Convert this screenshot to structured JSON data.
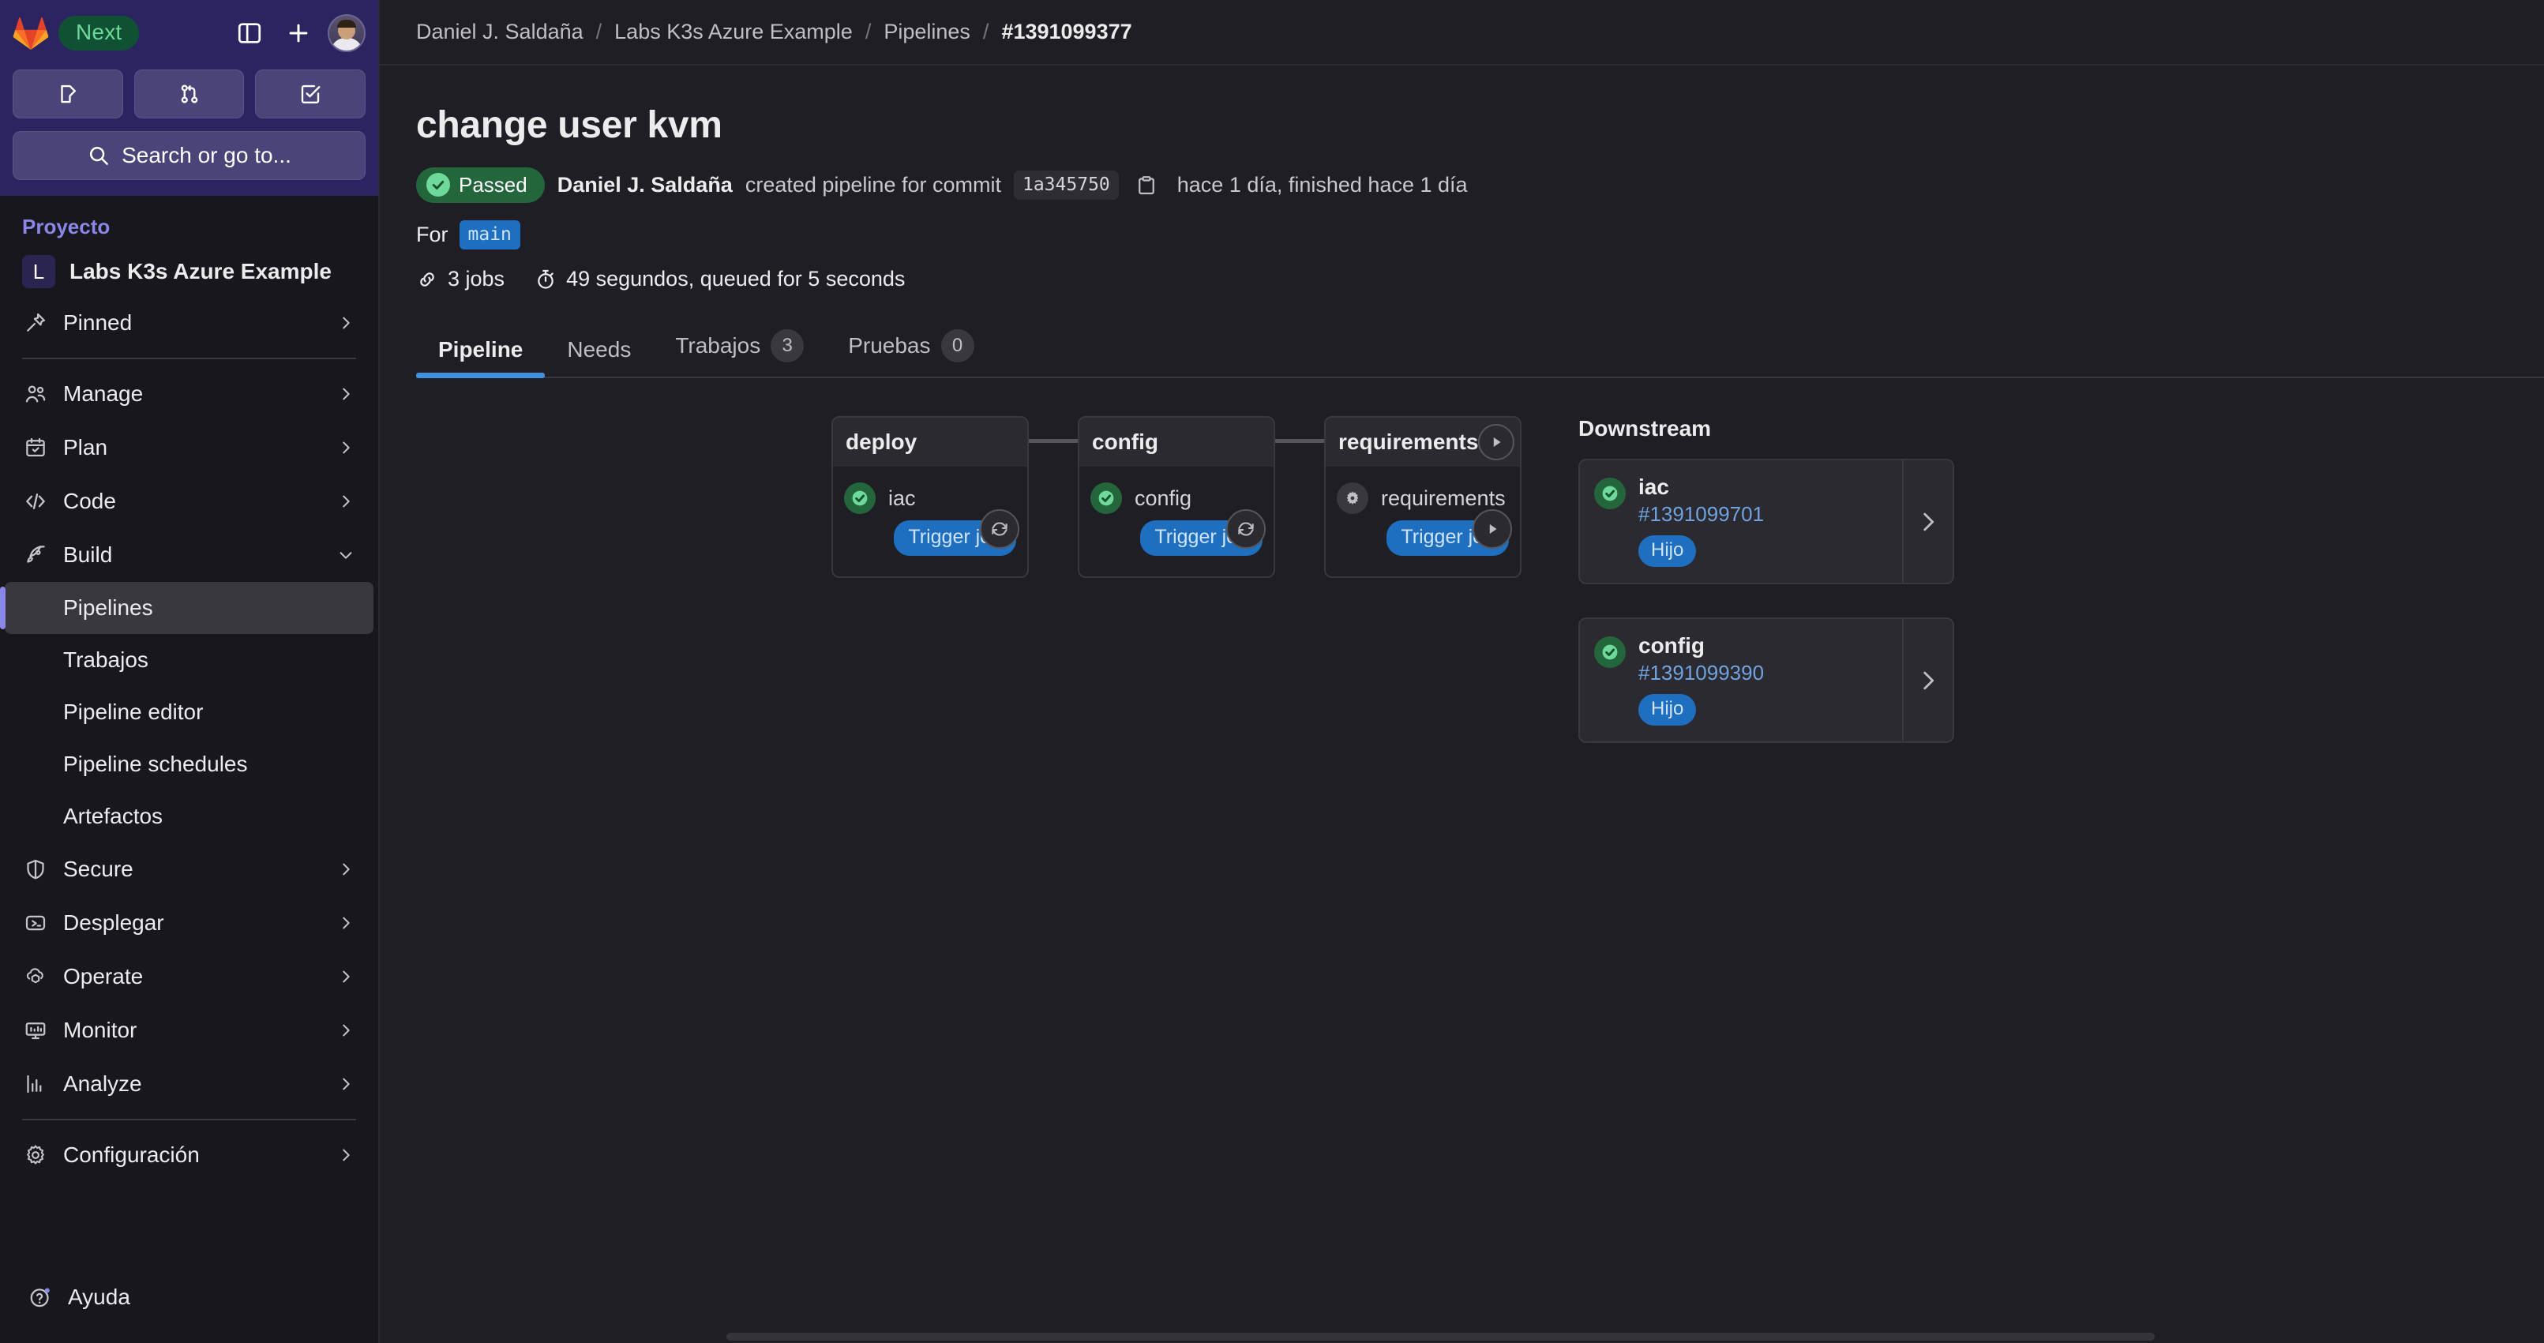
{
  "sidebar": {
    "brand": {
      "logo": "gitlab-logo",
      "next_badge": "Next"
    },
    "header_icons": [
      "sidebar-toggle-icon",
      "plus-icon",
      "avatar"
    ],
    "quick_buttons": [
      "issues-icon",
      "merge-requests-icon",
      "todos-icon"
    ],
    "search": {
      "placeholder": "Search or go to...",
      "label": "Search or go to..."
    },
    "section_label": "Proyecto",
    "project": {
      "initial": "L",
      "name": "Labs K3s Azure Example"
    },
    "nav": [
      {
        "label": "Pinned",
        "icon": "pin-icon",
        "chevron": "right"
      },
      {
        "label": "Manage",
        "icon": "users-icon",
        "chevron": "right"
      },
      {
        "label": "Plan",
        "icon": "calendar-icon",
        "chevron": "right"
      },
      {
        "label": "Code",
        "icon": "code-icon",
        "chevron": "right"
      },
      {
        "label": "Build",
        "icon": "rocket-icon",
        "chevron": "down"
      }
    ],
    "build_children": [
      {
        "label": "Pipelines",
        "active": true
      },
      {
        "label": "Trabajos",
        "active": false
      },
      {
        "label": "Pipeline editor",
        "active": false
      },
      {
        "label": "Pipeline schedules",
        "active": false
      },
      {
        "label": "Artefactos",
        "active": false
      }
    ],
    "nav_bottom": [
      {
        "label": "Secure",
        "icon": "shield-icon",
        "chevron": "right"
      },
      {
        "label": "Desplegar",
        "icon": "deploy-icon",
        "chevron": "right"
      },
      {
        "label": "Operate",
        "icon": "cloud-pod-icon",
        "chevron": "right"
      },
      {
        "label": "Monitor",
        "icon": "monitor-icon",
        "chevron": "right"
      },
      {
        "label": "Analyze",
        "icon": "chart-icon",
        "chevron": "right"
      }
    ],
    "settings": {
      "label": "Configuración",
      "icon": "gear-icon",
      "chevron": "right"
    },
    "help": {
      "label": "Ayuda",
      "icon": "help-icon"
    }
  },
  "breadcrumb": {
    "items": [
      "Daniel J. Saldaña",
      "Labs K3s Azure Example",
      "Pipelines",
      "#1391099377"
    ],
    "separator": "/"
  },
  "header": {
    "title": "change user kvm",
    "status_badge": "Passed",
    "author": "Daniel J. Saldaña",
    "created_text": "created pipeline for commit",
    "commit_sha": "1a345750",
    "copy_icon": "copy-icon",
    "time_text": "hace 1 día, finished hace 1 día",
    "for_label": "For",
    "ref": "main",
    "jobs_icon": "jobs-link-icon",
    "jobs_text": "3 jobs",
    "duration_icon": "timer-icon",
    "duration_text": "49 segundos, queued for 5 seconds"
  },
  "tabs": [
    {
      "label": "Pipeline",
      "count": null,
      "active": true
    },
    {
      "label": "Needs",
      "count": null,
      "active": false
    },
    {
      "label": "Trabajos",
      "count": "3",
      "active": false
    },
    {
      "label": "Pruebas",
      "count": "0",
      "active": false
    }
  ],
  "pipeline": {
    "stages": [
      {
        "name": "deploy",
        "head_action": null,
        "jobs": [
          {
            "name": "iac",
            "status": "success",
            "action": "retry-icon",
            "trigger_label": "Trigger job"
          }
        ]
      },
      {
        "name": "config",
        "head_action": null,
        "jobs": [
          {
            "name": "config",
            "status": "success",
            "action": "retry-icon",
            "trigger_label": "Trigger job"
          }
        ]
      },
      {
        "name": "requirements",
        "head_action": "play-icon",
        "jobs": [
          {
            "name": "requirements",
            "status": "manual",
            "action": "play-icon",
            "trigger_label": "Trigger job"
          }
        ]
      }
    ]
  },
  "downstream": {
    "title": "Downstream",
    "items": [
      {
        "name": "iac",
        "id": "#1391099701",
        "badge": "Hijo",
        "status": "success",
        "arrow": "chevron-right-icon"
      },
      {
        "name": "config",
        "id": "#1391099390",
        "badge": "Hijo",
        "status": "success",
        "arrow": "chevron-right-icon"
      }
    ]
  },
  "colors": {
    "sidebar_top": "#2b2460",
    "sidebar_bg": "#18171d",
    "page_bg": "#1f1e24",
    "accent_blue": "#428fdc",
    "link_blue": "#70a3e0",
    "success_green": "#24663b",
    "success_check": "#6ed99a",
    "badge_blue": "#1f6fc0",
    "next_green": "#0f5132"
  }
}
